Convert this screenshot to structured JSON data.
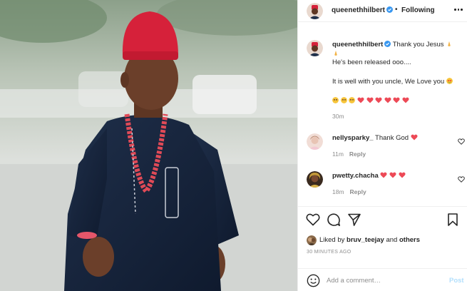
{
  "post": {
    "author": "queenethhilbert",
    "following_label": "Following",
    "dot": "•"
  },
  "caption": {
    "username": "queenethhilbert",
    "line1": "Thank you Jesus",
    "line2": "He's been released ooo....",
    "line3": "It is well with you uncle, We Love you",
    "time": "30m"
  },
  "comments": [
    {
      "username": "nellysparky_",
      "text": "Thank God",
      "time": "11m",
      "reply": "Reply"
    },
    {
      "username": "pwetty.chacha",
      "text": "",
      "time": "18m",
      "reply": "Reply"
    }
  ],
  "likes": {
    "prefix": "Liked by",
    "user": "bruv_teejay",
    "joiner": "and",
    "others": "others"
  },
  "timestamp": "30 MINUTES AGO",
  "add_comment": {
    "placeholder": "Add a comment…",
    "post_label": "Post"
  },
  "colors": {
    "heart_red": "#ed4956",
    "verified_blue": "#3897f0",
    "post_disabled": "#b2dffc"
  }
}
